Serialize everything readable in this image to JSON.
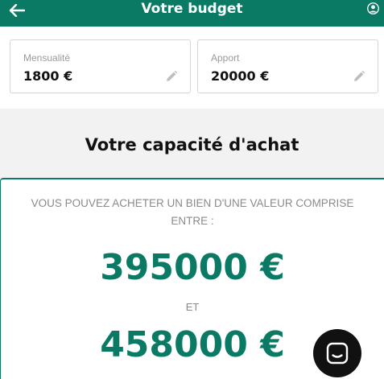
{
  "header": {
    "title": "Votre budget",
    "back_icon": "arrow-left-icon",
    "user_icon": "user-icon"
  },
  "fields": {
    "mensualite": {
      "label": "Mensualité",
      "value": "1800 €",
      "icon": "pencil-icon"
    },
    "apport": {
      "label": "Apport",
      "value": "20000 €",
      "icon": "pencil-icon"
    }
  },
  "capacity": {
    "title": "Votre capacité d'achat"
  },
  "result": {
    "text": "VOUS POUVEZ ACHETER UN BIEN D'UNE VALEUR COMPRISE ENTRE :",
    "min": "395000 €",
    "separator": "ET",
    "max": "458000 €"
  },
  "chat": {
    "icon": "chat-icon"
  },
  "colors": {
    "brand": "#0b7a64",
    "band": "#f2f2f2",
    "chat": "#111111"
  }
}
